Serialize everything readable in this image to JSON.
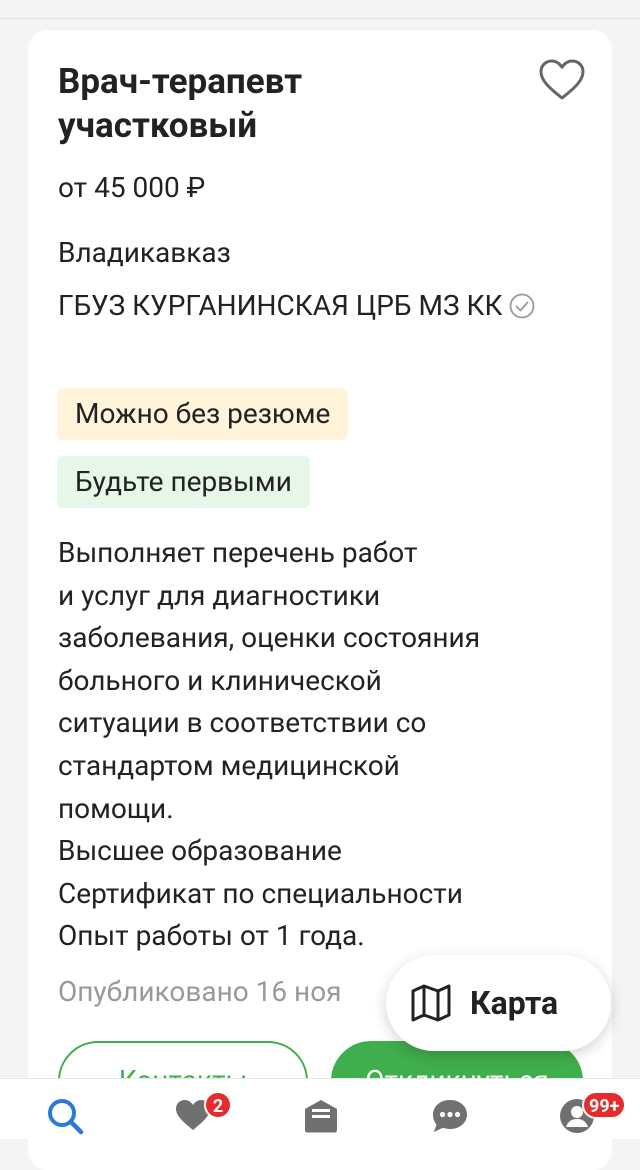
{
  "vacancy": {
    "title": "Врач-терапевт участковый",
    "salary": "от 45 000 ₽",
    "city": "Владикавказ",
    "employer": "ГБУЗ КУРГАНИНСКАЯ ЦРБ МЗ КК",
    "tags": [
      "Можно без резюме",
      "Будьте первыми"
    ],
    "description": "Выполняет перечень работ\nи услуг для диагностики\nзаболевания, оценки состояния\nбольного и клинической\nситуации в соответствии со\nстандартом медицинской\nпомощи.\nВысшее образование\nСертификат по специальности\nОпыт работы от 1 года.",
    "published": "Опубликовано 16 ноя",
    "contacts_label": "Контакты",
    "respond_label": "Откликнуться"
  },
  "map_button": {
    "label": "Карта"
  },
  "bottom_nav": {
    "favorites_badge": "2",
    "profile_badge": "99+"
  },
  "colors": {
    "accent_green": "#3fae4c",
    "search_blue": "#2b7bd6",
    "badge_red": "#e52b2b",
    "tag_yellow": "#fff4da",
    "tag_green": "#e6f6e8"
  }
}
